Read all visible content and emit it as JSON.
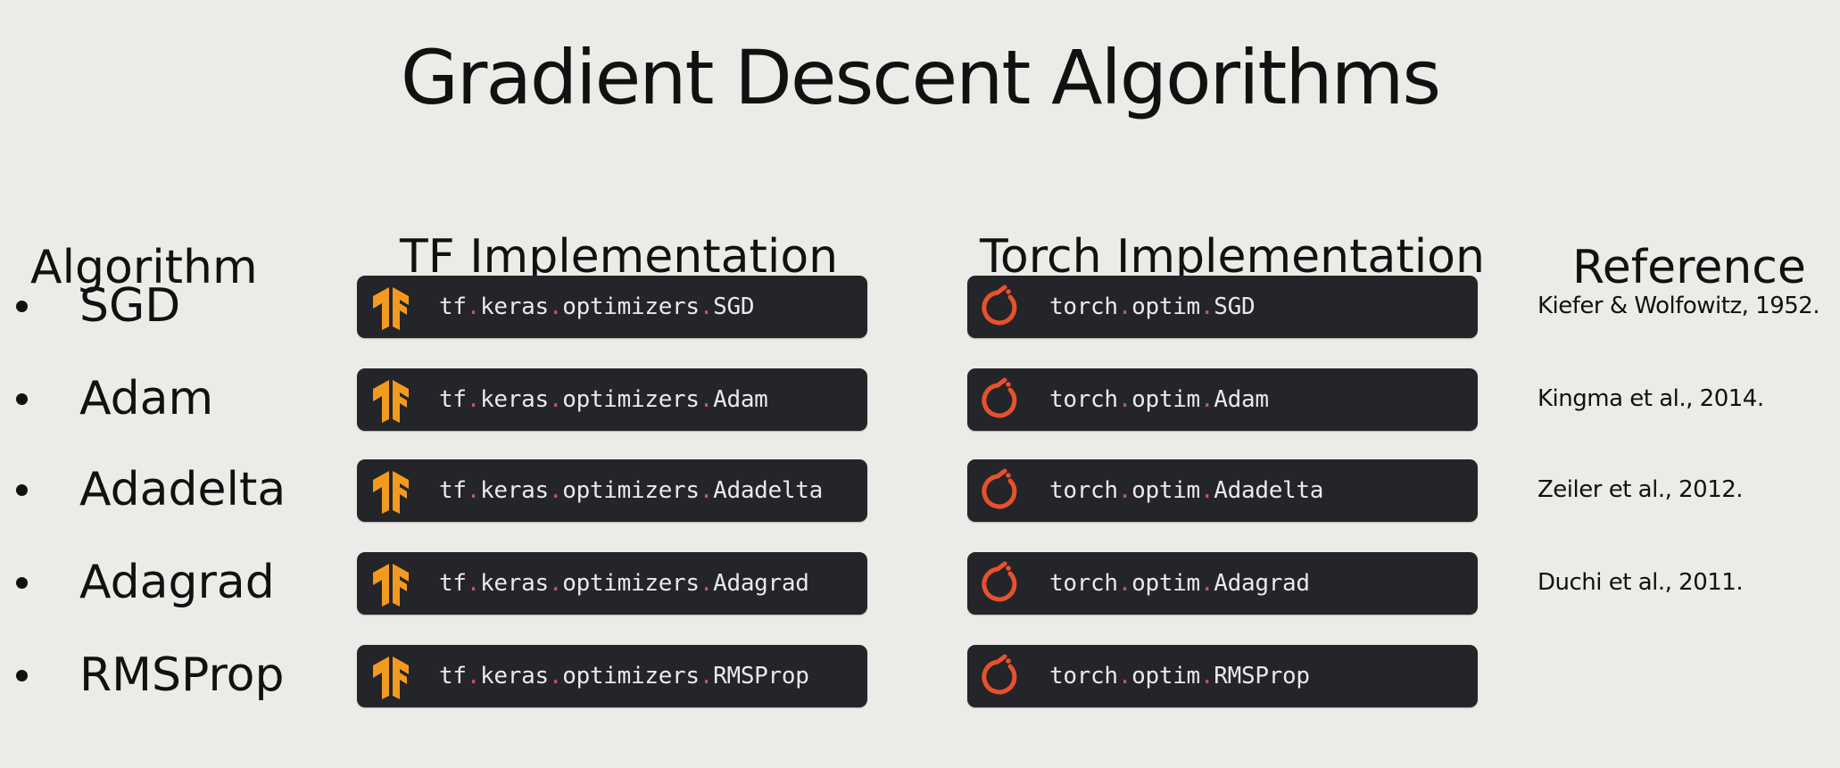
{
  "title": "Gradient Descent Algorithms",
  "headers": {
    "algorithm": "Algorithm",
    "tf": "TF Implementation",
    "torch": "Torch Implementation",
    "reference": "Reference"
  },
  "colors": {
    "background": "#ecebe8",
    "codebox": "#232529",
    "code_text": "#e9e9e9",
    "code_dot": "#c2556b",
    "tf_logo": "#f39a1e",
    "torch_logo": "#e8512d"
  },
  "icons": {
    "tf": "tensorflow-logo-icon",
    "torch": "pytorch-logo-icon"
  },
  "rows": [
    {
      "algorithm": "SGD",
      "tf": [
        "tf",
        "keras",
        "optimizers",
        "SGD"
      ],
      "torch": [
        "torch",
        "optim",
        "SGD"
      ],
      "reference": "Kiefer & Wolfowitz, 1952."
    },
    {
      "algorithm": "Adam",
      "tf": [
        "tf",
        "keras",
        "optimizers",
        "Adam"
      ],
      "torch": [
        "torch",
        "optim",
        "Adam"
      ],
      "reference": "Kingma et al., 2014."
    },
    {
      "algorithm": "Adadelta",
      "tf": [
        "tf",
        "keras",
        "optimizers",
        "Adadelta"
      ],
      "torch": [
        "torch",
        "optim",
        "Adadelta"
      ],
      "reference": "Zeiler et al., 2012."
    },
    {
      "algorithm": "Adagrad",
      "tf": [
        "tf",
        "keras",
        "optimizers",
        "Adagrad"
      ],
      "torch": [
        "torch",
        "optim",
        "Adagrad"
      ],
      "reference": "Duchi et al., 2011."
    },
    {
      "algorithm": "RMSProp",
      "tf": [
        "tf",
        "keras",
        "optimizers",
        "RMSProp"
      ],
      "torch": [
        "torch",
        "optim",
        "RMSProp"
      ],
      "reference": ""
    }
  ]
}
